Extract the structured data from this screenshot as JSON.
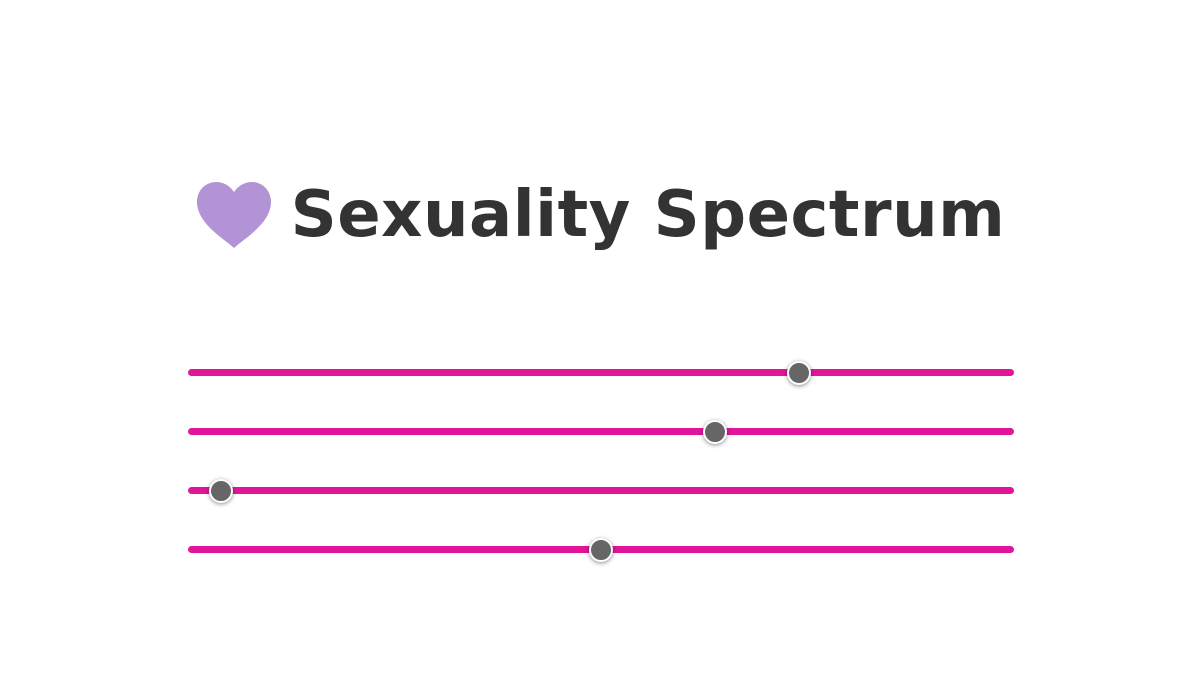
{
  "title": "Sexuality Spectrum",
  "icon": "purple-heart-icon",
  "colors": {
    "heart": "#b294d6",
    "title": "#333333",
    "track": "#e0159a",
    "thumb": "#666666"
  },
  "sliders": [
    {
      "value": 0.74
    },
    {
      "value": 0.638
    },
    {
      "value": 0.04
    },
    {
      "value": 0.5
    }
  ]
}
